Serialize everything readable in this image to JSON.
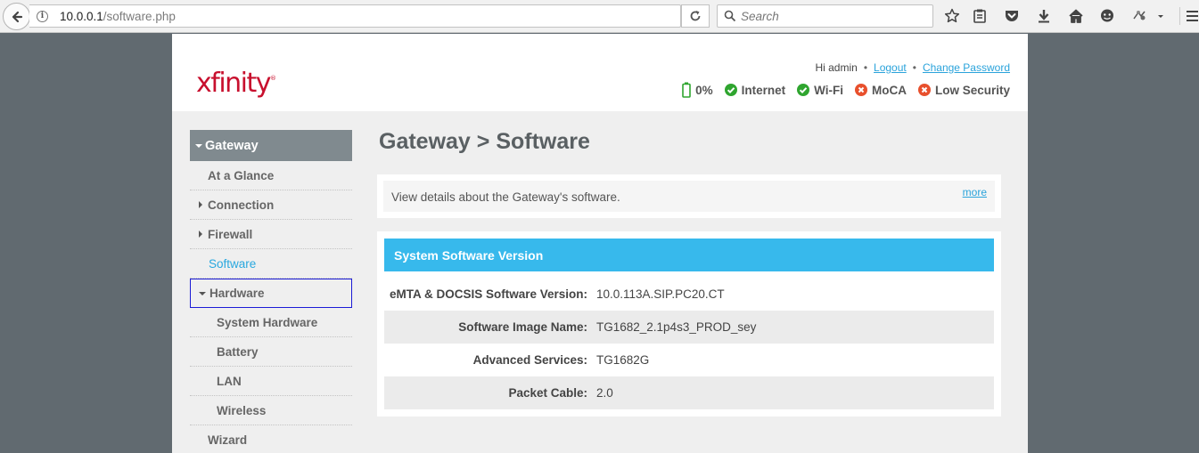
{
  "browser": {
    "url_host": "10.0.0.1",
    "url_path": "/software.php",
    "search_placeholder": "Search"
  },
  "header": {
    "logo": "xfinity",
    "greeting": "Hi admin",
    "logout": "Logout",
    "change_password": "Change Password",
    "status": {
      "battery": "0%",
      "internet": "Internet",
      "wifi": "Wi-Fi",
      "moca": "MoCA",
      "security": "Low Security"
    }
  },
  "colors": {
    "ok": "#2fa52f",
    "bad": "#e8502d",
    "accent": "#37b9ec",
    "brand": "#c8102e"
  },
  "nav": {
    "section": "Gateway",
    "items": [
      "At a Glance",
      "Connection",
      "Firewall",
      "Software",
      "Hardware",
      "System Hardware",
      "Battery",
      "LAN",
      "Wireless",
      "Wizard"
    ]
  },
  "main": {
    "title": "Gateway > Software",
    "description": "View details about the Gateway's software.",
    "more": "more",
    "section_title": "System Software Version",
    "rows": [
      {
        "label": "eMTA & DOCSIS Software Version:",
        "value": "10.0.113A.SIP.PC20.CT"
      },
      {
        "label": "Software Image Name:",
        "value": "TG1682_2.1p4s3_PROD_sey"
      },
      {
        "label": "Advanced Services:",
        "value": "TG1682G"
      },
      {
        "label": "Packet Cable:",
        "value": "2.0"
      }
    ]
  }
}
